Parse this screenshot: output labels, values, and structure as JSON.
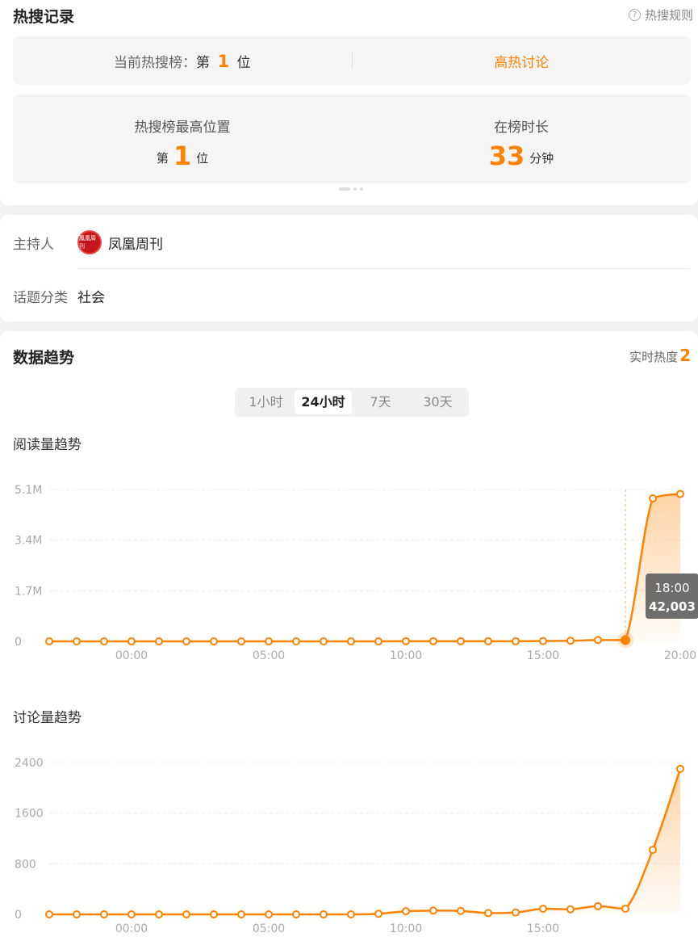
{
  "record": {
    "title": "热搜记录",
    "rule_link": "热搜规则",
    "rule_icon": "question-circle-icon",
    "current_prefix": "当前热搜榜：",
    "current_rank_pre": "第",
    "current_rank": "1",
    "current_rank_post": "位",
    "tag": "高热讨论",
    "peak_label": "热搜榜最高位置",
    "peak_pre": "第",
    "peak_rank": "1",
    "peak_post": "位",
    "duration_label": "在榜时长",
    "duration_value": "33",
    "duration_unit": "分钟"
  },
  "info": {
    "host_label": "主持人",
    "host_name": "凤凰周刊",
    "host_avatar_text": "鳳凰周刊",
    "category_label": "话题分类",
    "category_value": "社会"
  },
  "trend": {
    "title": "数据趋势",
    "heat_label": "实时热度",
    "heat_value": "2",
    "tabs": [
      "1小时",
      "24小时",
      "7天",
      "30天"
    ],
    "active_tab": 1
  },
  "chart_data": [
    {
      "type": "line",
      "title": "阅读量趋势",
      "xlabel": "",
      "ylabel": "",
      "ytick_labels": [
        "0",
        "1.7M",
        "3.4M",
        "5.1M"
      ],
      "yticks": [
        0,
        1700000,
        3400000,
        5100000
      ],
      "ylim": [
        0,
        5100000
      ],
      "xtick_labels": [
        "00:00",
        "05:00",
        "10:00",
        "15:00",
        "20:00"
      ],
      "xtick_index": [
        3,
        8,
        13,
        18,
        23
      ],
      "x": [
        "21:00",
        "22:00",
        "23:00",
        "00:00",
        "01:00",
        "02:00",
        "03:00",
        "04:00",
        "05:00",
        "06:00",
        "07:00",
        "08:00",
        "09:00",
        "10:00",
        "11:00",
        "12:00",
        "13:00",
        "14:00",
        "15:00",
        "16:00",
        "17:00",
        "18:00",
        "19:00",
        "20:00"
      ],
      "values": [
        0,
        0,
        0,
        0,
        0,
        0,
        0,
        0,
        0,
        0,
        0,
        0,
        0,
        5000,
        5000,
        5000,
        5000,
        5000,
        10000,
        20000,
        45000,
        42003,
        4800000,
        4950000
      ],
      "grid": true,
      "color": "#ff8200",
      "tooltip": {
        "index": 21,
        "time": "18:00",
        "value": "42,003"
      }
    },
    {
      "type": "line",
      "title": "讨论量趋势",
      "xlabel": "",
      "ylabel": "",
      "ytick_labels": [
        "0",
        "800",
        "1600",
        "2400"
      ],
      "yticks": [
        0,
        800,
        1600,
        2400
      ],
      "ylim": [
        0,
        2400
      ],
      "xtick_labels": [
        "00:00",
        "05:00",
        "10:00",
        "15:00"
      ],
      "xtick_index": [
        3,
        8,
        13,
        18
      ],
      "x": [
        "21:00",
        "22:00",
        "23:00",
        "00:00",
        "01:00",
        "02:00",
        "03:00",
        "04:00",
        "05:00",
        "06:00",
        "07:00",
        "08:00",
        "09:00",
        "10:00",
        "11:00",
        "12:00",
        "13:00",
        "14:00",
        "15:00",
        "16:00",
        "17:00",
        "18:00",
        "19:00",
        "20:00"
      ],
      "values": [
        0,
        0,
        0,
        0,
        0,
        0,
        0,
        0,
        0,
        0,
        0,
        0,
        10,
        50,
        60,
        55,
        20,
        30,
        90,
        80,
        130,
        90,
        1020,
        2300
      ],
      "grid": true,
      "color": "#ff8200"
    }
  ]
}
